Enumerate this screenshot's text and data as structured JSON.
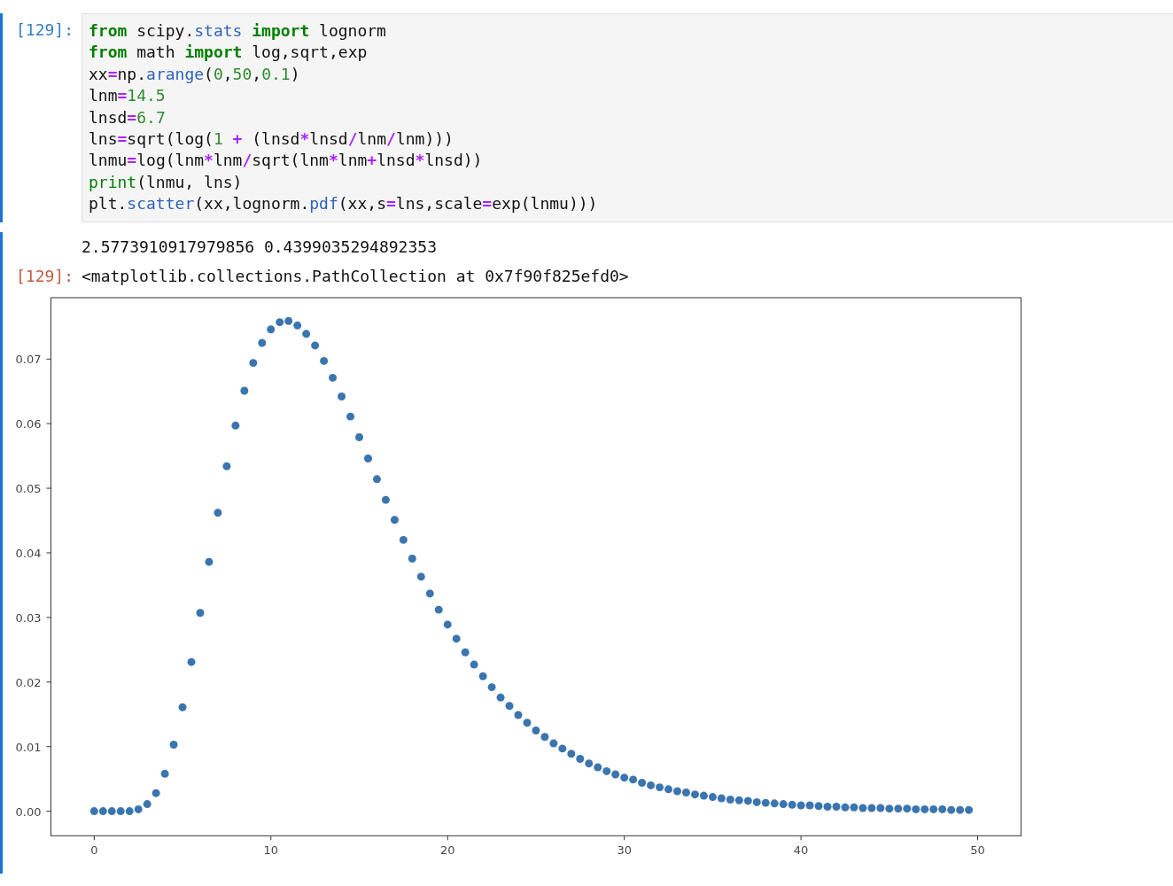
{
  "input_cell": {
    "prompt": "[129]:",
    "code_lines": [
      [
        {
          "kind": "kw",
          "text": "from"
        },
        {
          "kind": "plain",
          "text": " scipy."
        },
        {
          "kind": "attr",
          "text": "stats"
        },
        {
          "kind": "kw",
          "text": " import"
        },
        {
          "kind": "plain",
          "text": " lognorm"
        }
      ],
      [
        {
          "kind": "kw",
          "text": "from"
        },
        {
          "kind": "plain",
          "text": " math "
        },
        {
          "kind": "kw",
          "text": "import"
        },
        {
          "kind": "plain",
          "text": " log,sqrt,exp"
        }
      ],
      [
        {
          "kind": "plain",
          "text": "xx"
        },
        {
          "kind": "op",
          "text": "="
        },
        {
          "kind": "plain",
          "text": "np."
        },
        {
          "kind": "attr",
          "text": "arange"
        },
        {
          "kind": "plain",
          "text": "("
        },
        {
          "kind": "num",
          "text": "0"
        },
        {
          "kind": "plain",
          "text": ","
        },
        {
          "kind": "num",
          "text": "50"
        },
        {
          "kind": "plain",
          "text": ","
        },
        {
          "kind": "num",
          "text": "0.1"
        },
        {
          "kind": "plain",
          "text": ")"
        }
      ],
      [
        {
          "kind": "plain",
          "text": "lnm"
        },
        {
          "kind": "op",
          "text": "="
        },
        {
          "kind": "num",
          "text": "14.5"
        }
      ],
      [
        {
          "kind": "plain",
          "text": "lnsd"
        },
        {
          "kind": "op",
          "text": "="
        },
        {
          "kind": "num",
          "text": "6.7"
        }
      ],
      [
        {
          "kind": "plain",
          "text": "lns"
        },
        {
          "kind": "op",
          "text": "="
        },
        {
          "kind": "plain",
          "text": "sqrt(log("
        },
        {
          "kind": "num",
          "text": "1"
        },
        {
          "kind": "op",
          "text": " +"
        },
        {
          "kind": "plain",
          "text": " (lnsd"
        },
        {
          "kind": "op",
          "text": "*"
        },
        {
          "kind": "plain",
          "text": "lnsd"
        },
        {
          "kind": "op",
          "text": "/"
        },
        {
          "kind": "plain",
          "text": "lnm"
        },
        {
          "kind": "op",
          "text": "/"
        },
        {
          "kind": "plain",
          "text": "lnm)))"
        }
      ],
      [
        {
          "kind": "plain",
          "text": "lnmu"
        },
        {
          "kind": "op",
          "text": "="
        },
        {
          "kind": "plain",
          "text": "log(lnm"
        },
        {
          "kind": "op",
          "text": "*"
        },
        {
          "kind": "plain",
          "text": "lnm"
        },
        {
          "kind": "op",
          "text": "/"
        },
        {
          "kind": "plain",
          "text": "sqrt(lnm"
        },
        {
          "kind": "op",
          "text": "*"
        },
        {
          "kind": "plain",
          "text": "lnm"
        },
        {
          "kind": "op",
          "text": "+"
        },
        {
          "kind": "plain",
          "text": "lnsd"
        },
        {
          "kind": "op",
          "text": "*"
        },
        {
          "kind": "plain",
          "text": "lnsd))"
        }
      ],
      [
        {
          "kind": "builtin",
          "text": "print"
        },
        {
          "kind": "plain",
          "text": "(lnmu, lns)"
        }
      ],
      [
        {
          "kind": "plain",
          "text": "plt."
        },
        {
          "kind": "attr",
          "text": "scatter"
        },
        {
          "kind": "plain",
          "text": "(xx,lognorm."
        },
        {
          "kind": "attr",
          "text": "pdf"
        },
        {
          "kind": "plain",
          "text": "(xx,s"
        },
        {
          "kind": "op",
          "text": "="
        },
        {
          "kind": "plain",
          "text": "lns,scale"
        },
        {
          "kind": "op",
          "text": "="
        },
        {
          "kind": "plain",
          "text": "exp(lnmu)))"
        }
      ]
    ]
  },
  "output_cell": {
    "stream_text": "2.5773910917979856 0.4399035294892353",
    "result_prompt": "[129]:",
    "result_text": "<matplotlib.collections.PathCollection at 0x7f90f825efd0>",
    "chart_data": {
      "type": "scatter",
      "x": [
        0,
        0.5,
        1,
        1.5,
        2,
        2.5,
        3,
        3.5,
        4,
        4.5,
        5,
        5.5,
        6,
        6.5,
        7,
        7.5,
        8,
        8.5,
        9,
        9.5,
        10,
        10.5,
        11,
        11.5,
        12,
        12.5,
        13,
        13.5,
        14,
        14.5,
        15,
        15.5,
        16,
        16.5,
        17,
        17.5,
        18,
        18.5,
        19,
        19.5,
        20,
        20.5,
        21,
        21.5,
        22,
        22.5,
        23,
        23.5,
        24,
        24.5,
        25,
        25.5,
        26,
        26.5,
        27,
        27.5,
        28,
        28.5,
        29,
        29.5,
        30,
        30.5,
        31,
        31.5,
        32,
        32.5,
        33,
        33.5,
        34,
        34.5,
        35,
        35.5,
        36,
        36.5,
        37,
        37.5,
        38,
        38.5,
        39,
        39.5,
        40,
        40.5,
        41,
        41.5,
        42,
        42.5,
        43,
        43.5,
        44,
        44.5,
        45,
        45.5,
        46,
        46.5,
        47,
        47.5,
        48,
        48.5,
        49,
        49.5
      ],
      "series": [
        {
          "color": "#3b75af",
          "values": [
            0,
            0,
            0,
            0,
            0,
            0.0003,
            0.0011,
            0.0028,
            0.0058,
            0.0103,
            0.0161,
            0.0231,
            0.0307,
            0.0386,
            0.0462,
            0.0534,
            0.0597,
            0.0651,
            0.0694,
            0.0725,
            0.0746,
            0.0757,
            0.0759,
            0.0752,
            0.0739,
            0.0721,
            0.0697,
            0.0671,
            0.0642,
            0.0611,
            0.0579,
            0.0546,
            0.0514,
            0.0482,
            0.0451,
            0.042,
            0.0391,
            0.0363,
            0.0337,
            0.0312,
            0.0289,
            0.0267,
            0.0246,
            0.0227,
            0.0209,
            0.0192,
            0.0176,
            0.0163,
            0.0149,
            0.0137,
            0.0125,
            0.0115,
            0.0105,
            0.0097,
            0.0089,
            0.0081,
            0.0074,
            0.0068,
            0.0062,
            0.0057,
            0.0052,
            0.0049,
            0.0044,
            0.004,
            0.0037,
            0.0034,
            0.0031,
            0.0029,
            0.0026,
            0.0024,
            0.0022,
            0.002,
            0.0018,
            0.0017,
            0.0016,
            0.0014,
            0.0013,
            0.0012,
            0.0011,
            0.001,
            0.0009,
            0.0009,
            0.0008,
            0.0007,
            0.0007,
            0.0006,
            0.0006,
            0.0005,
            0.0005,
            0.0005,
            0.0004,
            0.0004,
            0.0004,
            0.0003,
            0.0003,
            0.0003,
            0.0003,
            0.0002,
            0.0002,
            0.0002
          ]
        }
      ],
      "xlim": [
        -2.45,
        52.45
      ],
      "ylim": [
        -0.0038,
        0.0795
      ],
      "xticks": [
        0,
        10,
        20,
        30,
        40,
        50
      ],
      "yticks": [
        {
          "value": 0,
          "label": "0.00"
        },
        {
          "value": 0.01,
          "label": "0.01"
        },
        {
          "value": 0.02,
          "label": "0.02"
        },
        {
          "value": 0.03,
          "label": "0.03"
        },
        {
          "value": 0.04,
          "label": "0.04"
        },
        {
          "value": 0.05,
          "label": "0.05"
        },
        {
          "value": 0.06,
          "label": "0.06"
        },
        {
          "value": 0.07,
          "label": "0.07"
        }
      ]
    }
  }
}
